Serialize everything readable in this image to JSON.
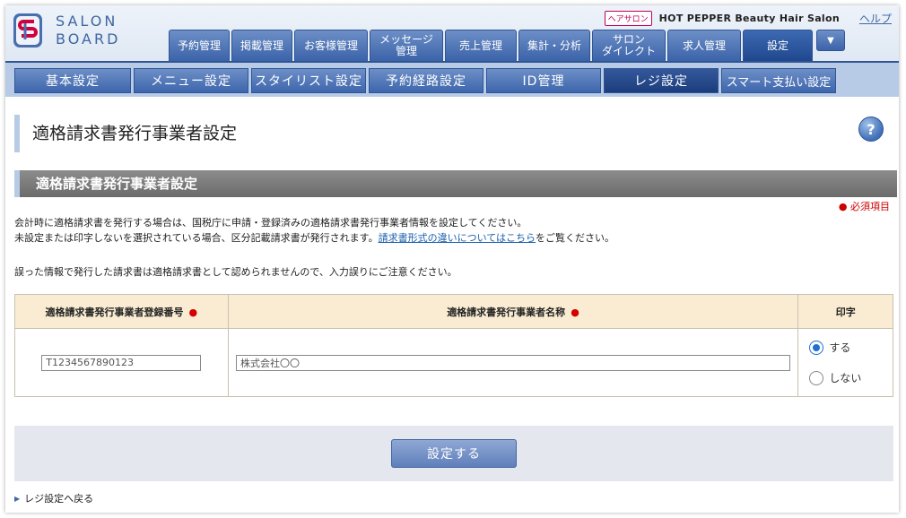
{
  "header": {
    "logo_line1": "SALON",
    "logo_line2": "BOARD",
    "brand_badge": "ヘアサロン",
    "brand_name": "HOT PEPPER Beauty Hair Salon",
    "help": "ヘルプ"
  },
  "main_tabs": [
    {
      "label": "予約管理",
      "active": false
    },
    {
      "label": "掲載管理",
      "active": false
    },
    {
      "label": "お客様管理",
      "active": false
    },
    {
      "label": "メッセージ\n管理",
      "active": false
    },
    {
      "label": "売上管理",
      "active": false
    },
    {
      "label": "集計・分析",
      "active": false
    },
    {
      "label": "サロン\nダイレクト",
      "active": false
    },
    {
      "label": "求人管理",
      "active": false
    },
    {
      "label": "設定",
      "active": true
    }
  ],
  "subnav": [
    {
      "label": "基本設定",
      "active": false
    },
    {
      "label": "メニュー設定",
      "active": false
    },
    {
      "label": "スタイリスト設定",
      "active": false
    },
    {
      "label": "予約経路設定",
      "active": false
    },
    {
      "label": "ID管理",
      "active": false
    },
    {
      "label": "レジ設定",
      "active": true
    },
    {
      "label": "スマート支払い設定",
      "active": false
    }
  ],
  "page": {
    "title": "適格請求書発行事業者設定",
    "help_icon": "?",
    "section_title": "適格請求書発行事業者設定",
    "required_note": "必須項目",
    "desc_line1": "会計時に適格請求書を発行する場合は、国税庁に申請・登録済みの適格請求書発行事業者情報を設定してください。",
    "desc_line2_pre": "未設定または印字しないを選択されている場合、区分記載請求書が発行されます。",
    "desc_line2_link": "請求書形式の違いについてはこちら",
    "desc_line2_post": "をご覧ください。",
    "desc_line3": "誤った情報で発行した請求書は適格請求書として認められませんので、入力誤りにご注意ください。"
  },
  "table": {
    "col_reg_number": "適格請求書発行事業者登録番号",
    "col_name": "適格請求書発行事業者名称",
    "col_print": "印字",
    "reg_number_value": "T1234567890123",
    "name_value": "株式会社〇〇",
    "print_yes": "する",
    "print_no": "しない",
    "selected": "yes"
  },
  "actions": {
    "submit": "設定する",
    "back": "レジ設定へ戻る"
  },
  "colors": {
    "brand_blue": "#3f67a3",
    "required_red": "#d40000",
    "header_bg": "#f9ecd3"
  }
}
